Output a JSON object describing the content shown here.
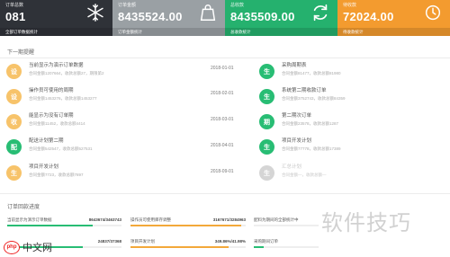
{
  "cards": [
    {
      "title": "订单总数",
      "value": "081",
      "foot": "全部订单数据统计",
      "color": "#2f3238",
      "icon": "snowflake-icon"
    },
    {
      "title": "订单金额",
      "value": "8435524.00",
      "foot": "订单金额统计",
      "color": "#9aa0a4",
      "icon": "bag-icon"
    },
    {
      "title": "总收款",
      "value": "8435509.00",
      "foot": "总收款统计",
      "color": "#25b16e",
      "icon": "refresh-icon"
    },
    {
      "title": "待收款",
      "value": "72024.00",
      "foot": "待收款统计",
      "color": "#f39b2f",
      "icon": "clock-icon"
    }
  ],
  "todo": {
    "title": "下一期提醒",
    "left": [
      {
        "badge": "设",
        "badge_style": "orange",
        "name": "当前显示为演示订单数据",
        "sub": "合同金额1207664，收款总额27，期限第2",
        "date": "2018-01-01"
      },
      {
        "badge": "设",
        "badge_style": "orange",
        "name": "操作员可使用的周期",
        "sub": "合同金额1453276，收款总额1453277",
        "date": "2018-02-01"
      },
      {
        "badge": "收",
        "badge_style": "orange",
        "name": "能显示为没有订单期",
        "sub": "合同金额11452，收款总额4414",
        "date": "2018-03-01"
      },
      {
        "badge": "配",
        "badge_style": "green",
        "name": "配送计划第二期",
        "sub": "合同金额542547，收款总额527531",
        "date": "2018-04-01"
      },
      {
        "badge": "生",
        "badge_style": "orange",
        "name": "项目开发计划",
        "sub": "合同金额7723，收款总额7897",
        "date": "2018-09-01"
      }
    ],
    "right": [
      {
        "badge": "生",
        "badge_style": "green",
        "name": "采购周期表",
        "sub": "合同金额81477，收款总额81980"
      },
      {
        "badge": "生",
        "badge_style": "green",
        "name": "系统第二期收款订单",
        "sub": "合同金额3752743，收款总额84359"
      },
      {
        "badge": "期",
        "badge_style": "green",
        "name": "第二期次订单",
        "sub": "合同金额23578，收款总额1287"
      },
      {
        "badge": "生",
        "badge_style": "green",
        "name": "项目开发计划",
        "sub": "合同金额77778，收款总额17389"
      },
      {
        "badge": "生",
        "badge_style": "gray",
        "name": "汇总计划",
        "sub": "合同金额—，收款总额—"
      }
    ]
  },
  "progress": {
    "title": "订单回款进度",
    "items": [
      {
        "label": "当前显示为演示订单数据",
        "value": "8643674/3463743",
        "fraction": 0.75,
        "color": "#28bd74"
      },
      {
        "label": "操作员可使用库存调整",
        "value": "3167671/3284963",
        "fraction": 0.96,
        "color": "#f3a83a"
      },
      {
        "label": "配料为期间的全部统计中",
        "value": "",
        "fraction": 0.0,
        "color": "#28bd74"
      },
      {
        "label": "",
        "value": "24837/37368",
        "fraction": 0.66,
        "color": "#28bd74"
      },
      {
        "label": "项目开发计划",
        "value": "349.86%/41.98%",
        "fraction": 0.85,
        "color": "#f3a83a"
      },
      {
        "label": "采购期间订单",
        "value": "",
        "fraction": 0.15,
        "color": "#28bd74"
      }
    ]
  },
  "watermark": "软件技巧",
  "logo": {
    "badge": "php",
    "text": "中文网"
  }
}
